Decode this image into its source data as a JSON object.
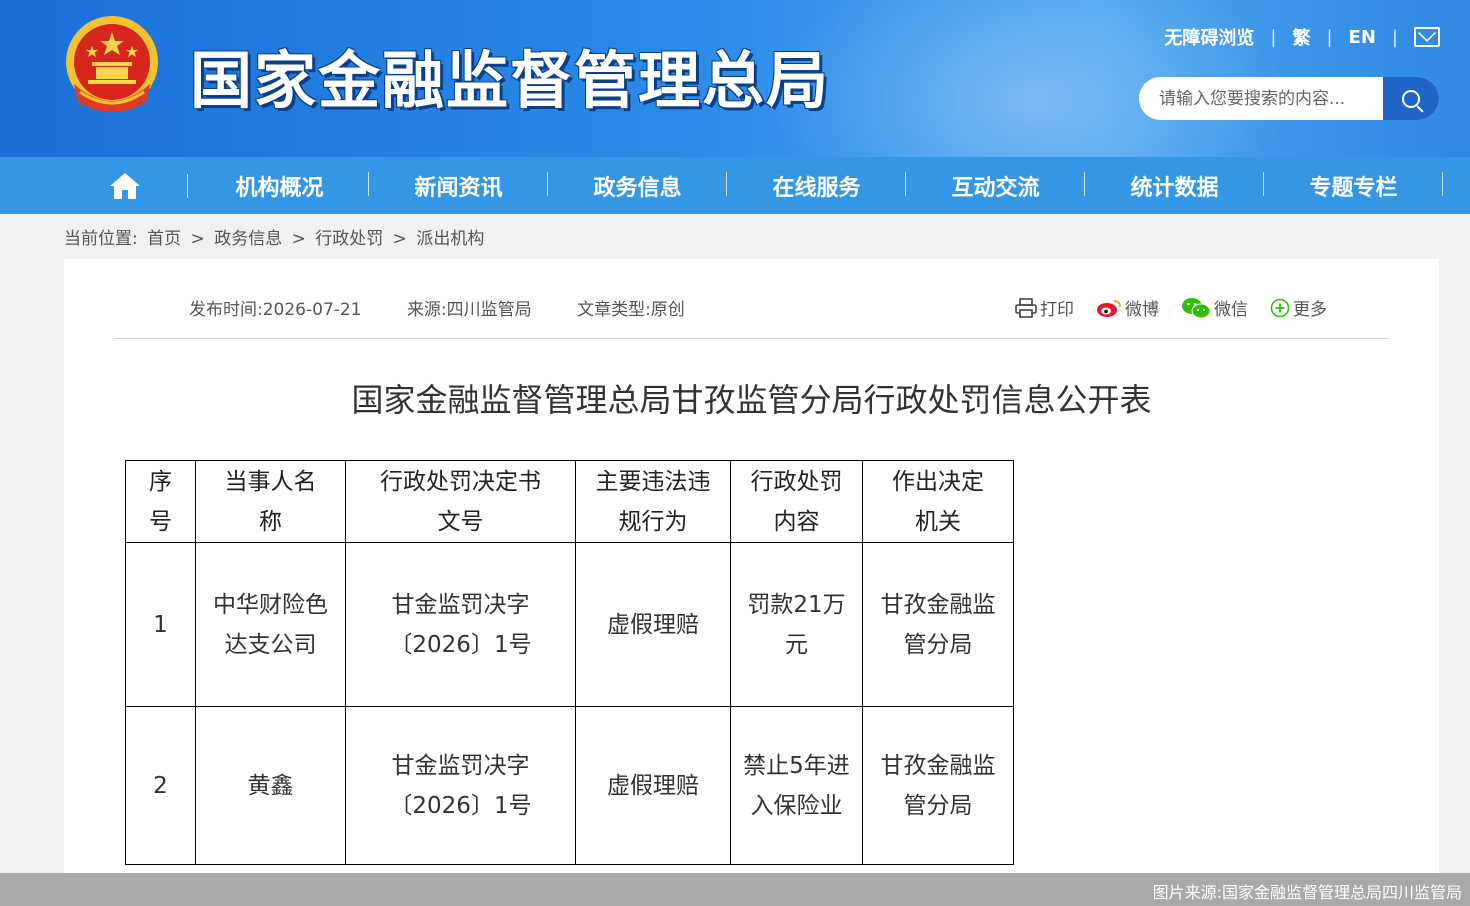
{
  "header": {
    "site_title": "国家金融监督管理总局",
    "toplinks": [
      "无障碍浏览",
      "繁",
      "EN"
    ],
    "search_placeholder": "请输入您要搜索的内容..."
  },
  "nav": {
    "items": [
      "机构概况",
      "新闻资讯",
      "政务信息",
      "在线服务",
      "互动交流",
      "统计数据",
      "专题专栏"
    ]
  },
  "breadcrumb": {
    "prefix": "当前位置:",
    "items": [
      "首页",
      "政务信息",
      "行政处罚",
      "派出机构"
    ],
    "sep": ">"
  },
  "article": {
    "meta": {
      "publish": "发布时间:2026-07-21",
      "source": "来源:四川监管局",
      "type": "文章类型:原创"
    },
    "share": [
      "打印",
      "微博",
      "微信",
      "更多"
    ],
    "title": "国家金融监督管理总局甘孜监管分局行政处罚信息公开表",
    "table": {
      "headers": [
        [
          "序",
          "号"
        ],
        [
          "当事人名",
          "称"
        ],
        [
          "行政处罚决定书",
          "文号"
        ],
        [
          "主要违法违",
          "规行为"
        ],
        [
          "行政处罚",
          "内容"
        ],
        [
          "作出决定",
          "机关"
        ]
      ],
      "rows": [
        {
          "no": "1",
          "party": [
            "中华财险色",
            "达支公司"
          ],
          "doc": [
            "甘金监罚决字",
            "〔2026〕1号"
          ],
          "violation": "虚假理赔",
          "penalty": [
            "罚款21万",
            "元"
          ],
          "authority": [
            "甘孜金融监",
            "管分局"
          ]
        },
        {
          "no": "2",
          "party": [
            "黄鑫"
          ],
          "doc": [
            "甘金监罚决字",
            "〔2026〕1号"
          ],
          "violation": "虚假理赔",
          "penalty": [
            "禁止5年进",
            "入保险业"
          ],
          "authority": [
            "甘孜金融监",
            "管分局"
          ]
        }
      ]
    }
  },
  "credit": "图片来源:国家金融监督管理总局四川监管局",
  "colors": {
    "header_blue": "#1a6fd6",
    "nav_blue": "#3497e6",
    "search_btn": "#2064c7"
  }
}
